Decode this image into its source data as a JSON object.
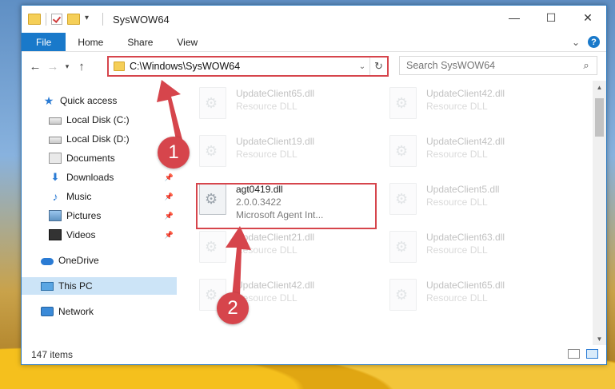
{
  "window": {
    "title": "SysWOW64",
    "controls": {
      "minimize": "—",
      "maximize": "☐",
      "close": "✕"
    }
  },
  "ribbon": {
    "tabs": [
      "File",
      "Home",
      "Share",
      "View"
    ],
    "collapse_glyph": "⌄",
    "help_glyph": "?"
  },
  "address_bar": {
    "path": "C:\\Windows\\SysWOW64",
    "dropdown_glyph": "⌄",
    "refresh_glyph": "↻"
  },
  "search": {
    "placeholder": "Search SysWOW64",
    "icon": "search-icon"
  },
  "navigation_pane": {
    "items": [
      {
        "label": "Quick access",
        "icon": "star-icon",
        "pinned": false
      },
      {
        "label": "Local Disk (C:)",
        "icon": "drive-icon",
        "pinned": false
      },
      {
        "label": "Local Disk (D:)",
        "icon": "drive-icon",
        "pinned": false
      },
      {
        "label": "Documents",
        "icon": "documents-icon",
        "pinned": false
      },
      {
        "label": "Downloads",
        "icon": "downloads-icon",
        "pinned": true
      },
      {
        "label": "Music",
        "icon": "music-icon",
        "pinned": true
      },
      {
        "label": "Pictures",
        "icon": "pictures-icon",
        "pinned": true
      },
      {
        "label": "Videos",
        "icon": "videos-icon",
        "pinned": true
      },
      {
        "label": "OneDrive",
        "icon": "onedrive-icon",
        "pinned": false
      },
      {
        "label": "This PC",
        "icon": "this-pc-icon",
        "pinned": false,
        "selected": true
      },
      {
        "label": "Network",
        "icon": "network-icon",
        "pinned": false
      }
    ]
  },
  "files": [
    {
      "name": "UpdateClient65.dll",
      "type": "Resource DLL",
      "faded": true
    },
    {
      "name": "UpdateClient42.dll",
      "type": "Resource DLL",
      "faded": true
    },
    {
      "name": "UpdateClient19.dll",
      "type": "Resource DLL",
      "faded": true
    },
    {
      "name": "UpdateClient42.dll",
      "type": "Resource DLL",
      "faded": true
    },
    {
      "name": "agt0419.dll",
      "version": "2.0.0.3422",
      "type": "Microsoft Agent Int...",
      "faded": false,
      "highlighted": true
    },
    {
      "name": "UpdateClient5.dll",
      "type": "Resource DLL",
      "faded": true
    },
    {
      "name": "UpdateClient21.dll",
      "type": "Resource DLL",
      "faded": true
    },
    {
      "name": "UpdateClient63.dll",
      "type": "Resource DLL",
      "faded": true
    },
    {
      "name": "UpdateClient42.dll",
      "type": "Resource DLL",
      "faded": true
    },
    {
      "name": "UpdateClient65.dll",
      "type": "Resource DLL",
      "faded": true
    }
  ],
  "status": {
    "item_count": "147 items"
  },
  "annotations": {
    "step1": "1",
    "step2": "2",
    "color": "#d6454c"
  }
}
